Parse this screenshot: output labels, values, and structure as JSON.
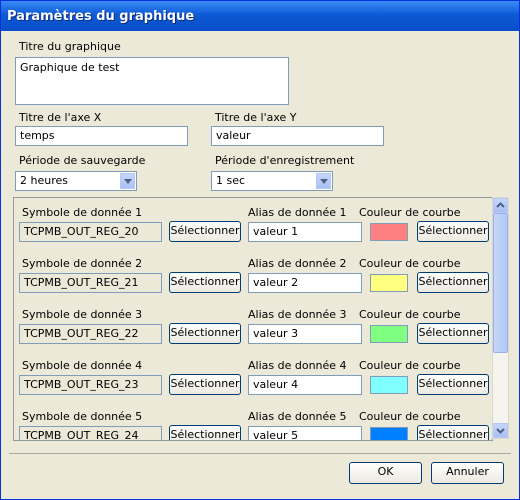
{
  "window": {
    "title": "Paramètres du graphique"
  },
  "graph_title": {
    "label": "Titre du graphique",
    "value": "Graphique de test"
  },
  "axis_x": {
    "label": "Titre de l'axe X",
    "value": "temps"
  },
  "axis_y": {
    "label": "Titre de l'axe Y",
    "value": "valeur"
  },
  "save_period": {
    "label": "Période de sauvegarde",
    "value": "2 heures"
  },
  "record_period": {
    "label": "Période d'enregistrement",
    "value": "1 sec"
  },
  "series": [
    {
      "symbol_label": "Symbole de donnée 1",
      "symbol": "TCPMB_OUT_REG_20",
      "alias_label": "Alias de donnée 1",
      "alias": "valeur 1",
      "color_label": "Couleur de courbe",
      "color": "#ff8080"
    },
    {
      "symbol_label": "Symbole de donnée 2",
      "symbol": "TCPMB_OUT_REG_21",
      "alias_label": "Alias de donnée 2",
      "alias": "valeur 2",
      "color_label": "Couleur de courbe",
      "color": "#ffff80"
    },
    {
      "symbol_label": "Symbole de donnée 3",
      "symbol": "TCPMB_OUT_REG_22",
      "alias_label": "Alias de donnée 3",
      "alias": "valeur 3",
      "color_label": "Couleur de courbe",
      "color": "#80ff80"
    },
    {
      "symbol_label": "Symbole de donnée 4",
      "symbol": "TCPMB_OUT_REG_23",
      "alias_label": "Alias de donnée 4",
      "alias": "valeur 4",
      "color_label": "Couleur de courbe",
      "color": "#80ffff"
    },
    {
      "symbol_label": "Symbole de donnée 5",
      "symbol": "TCPMB_OUT_REG_24",
      "alias_label": "Alias de donnée 5",
      "alias": "valeur 5",
      "color_label": "Couleur de courbe",
      "color": "#0080ff"
    }
  ],
  "select_label": "Sélectionner",
  "footer": {
    "ok": "OK",
    "cancel": "Annuler"
  }
}
